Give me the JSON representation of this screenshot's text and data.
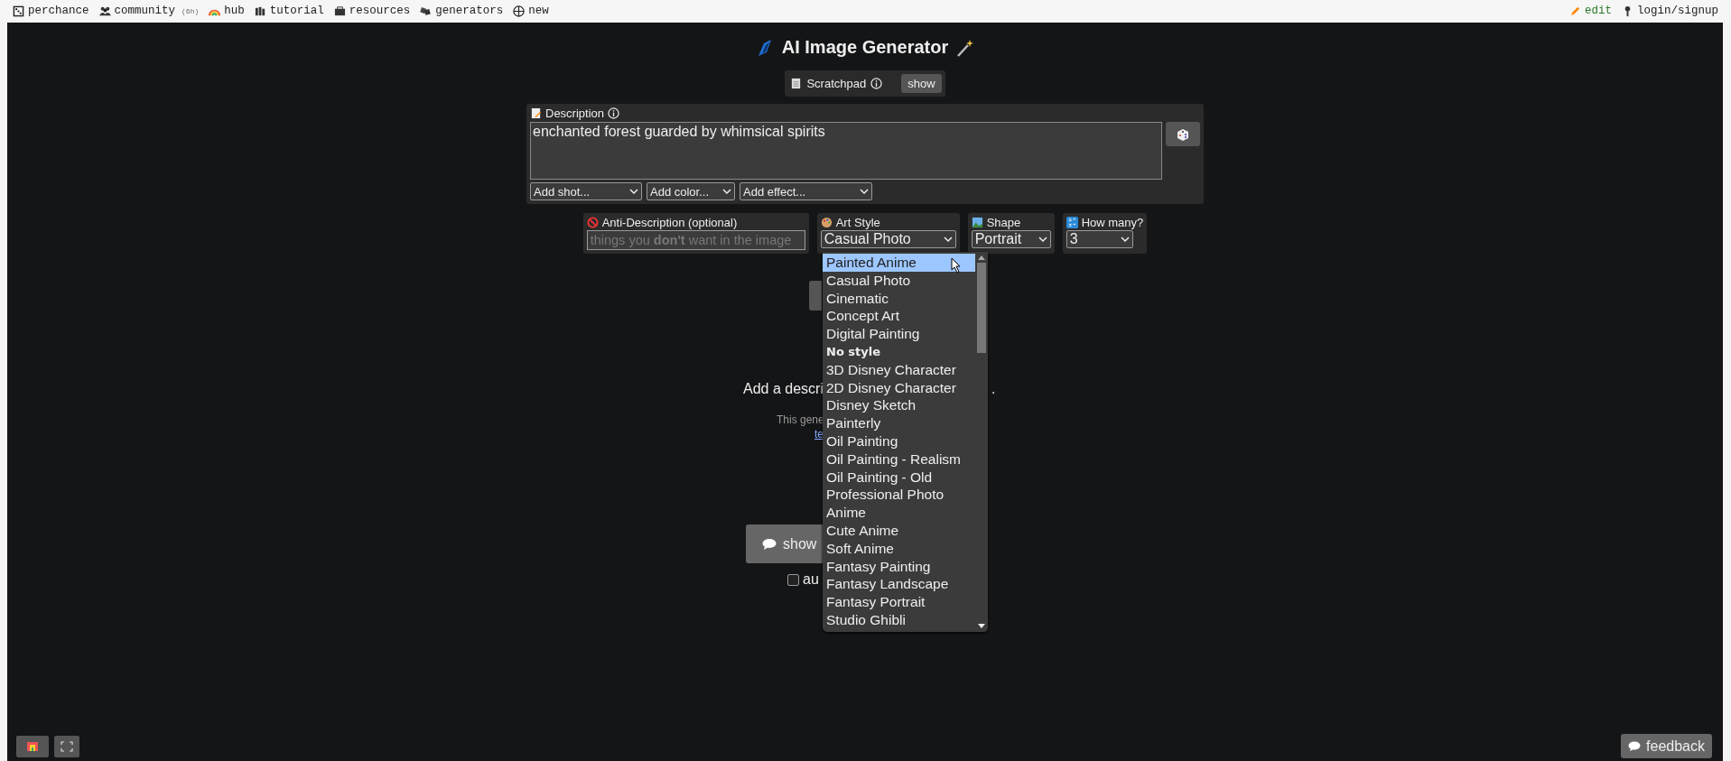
{
  "nav": {
    "left": [
      {
        "label": "perchance"
      },
      {
        "label": "community",
        "badge": "(6h)"
      },
      {
        "label": "hub"
      },
      {
        "label": "tutorial"
      },
      {
        "label": "resources"
      },
      {
        "label": "generators"
      },
      {
        "label": "new"
      }
    ],
    "right": [
      {
        "label": "edit"
      },
      {
        "label": "login/signup"
      }
    ]
  },
  "title": "AI Image Generator",
  "scratchpad": {
    "label": "Scratchpad",
    "button": "show"
  },
  "description": {
    "label": "Description",
    "value": "enchanted forest guarded by whimsical spirits",
    "selects": [
      "Add shot...",
      "Add color...",
      "Add effect..."
    ]
  },
  "anti_description": {
    "label": "Anti-Description (optional)",
    "placeholder": "things you **don't** want in the image"
  },
  "art_style": {
    "label": "Art Style",
    "value": "Casual Photo",
    "options": [
      {
        "label": "Painted Anime",
        "kind": "option",
        "highlighted": true
      },
      {
        "label": "Casual Photo",
        "kind": "option",
        "highlighted": false
      },
      {
        "label": "Cinematic",
        "kind": "option",
        "highlighted": false
      },
      {
        "label": "Concept Art",
        "kind": "option",
        "highlighted": false
      },
      {
        "label": "Digital Painting",
        "kind": "option",
        "highlighted": false
      },
      {
        "label": "No style",
        "kind": "heading",
        "highlighted": false
      },
      {
        "label": "3D Disney Character",
        "kind": "option",
        "highlighted": false
      },
      {
        "label": "2D Disney Character",
        "kind": "option",
        "highlighted": false
      },
      {
        "label": "Disney Sketch",
        "kind": "option",
        "highlighted": false
      },
      {
        "label": "Painterly",
        "kind": "option",
        "highlighted": false
      },
      {
        "label": "Oil Painting",
        "kind": "option",
        "highlighted": false
      },
      {
        "label": "Oil Painting - Realism",
        "kind": "option",
        "highlighted": false
      },
      {
        "label": "Oil Painting - Old",
        "kind": "option",
        "highlighted": false
      },
      {
        "label": "Professional Photo",
        "kind": "option",
        "highlighted": false
      },
      {
        "label": "Anime",
        "kind": "option",
        "highlighted": false
      },
      {
        "label": "Cute Anime",
        "kind": "option",
        "highlighted": false
      },
      {
        "label": "Soft Anime",
        "kind": "option",
        "highlighted": false
      },
      {
        "label": "Fantasy Painting",
        "kind": "option",
        "highlighted": false
      },
      {
        "label": "Fantasy Landscape",
        "kind": "option",
        "highlighted": false
      },
      {
        "label": "Fantasy Portrait",
        "kind": "option",
        "highlighted": false
      },
      {
        "label": "Studio Ghibli",
        "kind": "option",
        "highlighted": false
      }
    ]
  },
  "shape": {
    "label": "Shape",
    "value": "Portrait"
  },
  "count": {
    "label": "How many?",
    "value": "3"
  },
  "behind": {
    "prompt": "Add a descri",
    "prompt_tail": ".",
    "note": "This gene",
    "link": "te",
    "show_button": "show",
    "auto_checkbox": {
      "label": "au",
      "checked": false
    }
  },
  "feedback": "feedback"
}
